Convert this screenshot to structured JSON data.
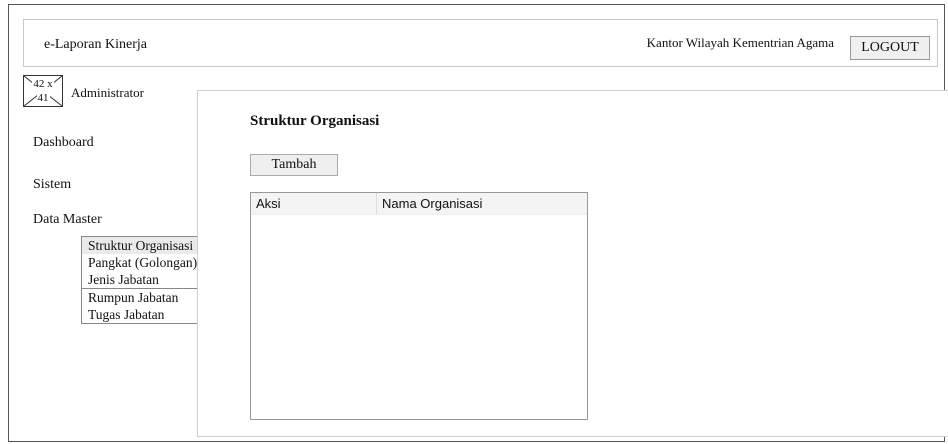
{
  "header": {
    "app_title": "e-Laporan Kinerja",
    "org_name": "Kantor Wilayah Kementrian Agama",
    "logout_label": "LOGOUT"
  },
  "sidebar": {
    "avatar_placeholder_line1": "42 x",
    "avatar_placeholder_line2": "41",
    "user_name": "Administrator",
    "items": [
      {
        "label": "Dashboard"
      },
      {
        "label": "Sistem"
      },
      {
        "label": "Data Master"
      }
    ],
    "submenu": [
      {
        "label": "Struktur Organisasi",
        "active": true
      },
      {
        "label": "Pangkat (Golongan)"
      },
      {
        "label": "Jenis Jabatan"
      },
      {
        "label": "Rumpun Jabatan"
      },
      {
        "label": "Tugas Jabatan"
      }
    ]
  },
  "main": {
    "title": "Struktur Organisasi",
    "add_button_label": "Tambah",
    "table": {
      "columns": [
        "Aksi",
        "Nama Organisasi"
      ],
      "rows": []
    }
  }
}
